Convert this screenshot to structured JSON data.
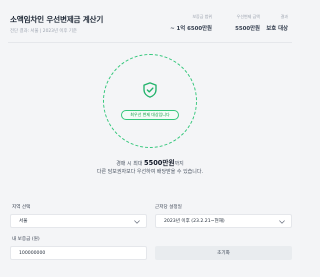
{
  "header": {
    "title": "소액임차인 우선변제금 계산기",
    "subtitle": "전단 결과: 서울 | 2023년 이후 기준"
  },
  "stats": [
    {
      "label": "보증금 범위",
      "value": "~ 1억 6500만원"
    },
    {
      "label": "우선변제 금액",
      "value": "5500만원"
    },
    {
      "label": "결과",
      "value": "보호 대상"
    }
  ],
  "result": {
    "badge": "최우선 변제 대상입니다",
    "line1_prefix": "경매 시 최대",
    "amount": "5500만원",
    "line1_suffix": "까지",
    "line2": "다른 담보권자보다 우선하여 배당받을 수 있습니다."
  },
  "form": {
    "region_label": "지역 선택",
    "region_value": "서울",
    "date_label": "근저당 설정일",
    "date_value": "2023년 이후 (23.2.21~현재)",
    "deposit_label": "내 보증금 (원)",
    "deposit_value": "100000000",
    "reset_label": "초기화"
  },
  "colors": {
    "accent": "#34c77b",
    "accent_text": "#16a34a"
  },
  "icons": {
    "shield": "shield-check-icon",
    "chevron": "chevron-down-icon"
  }
}
